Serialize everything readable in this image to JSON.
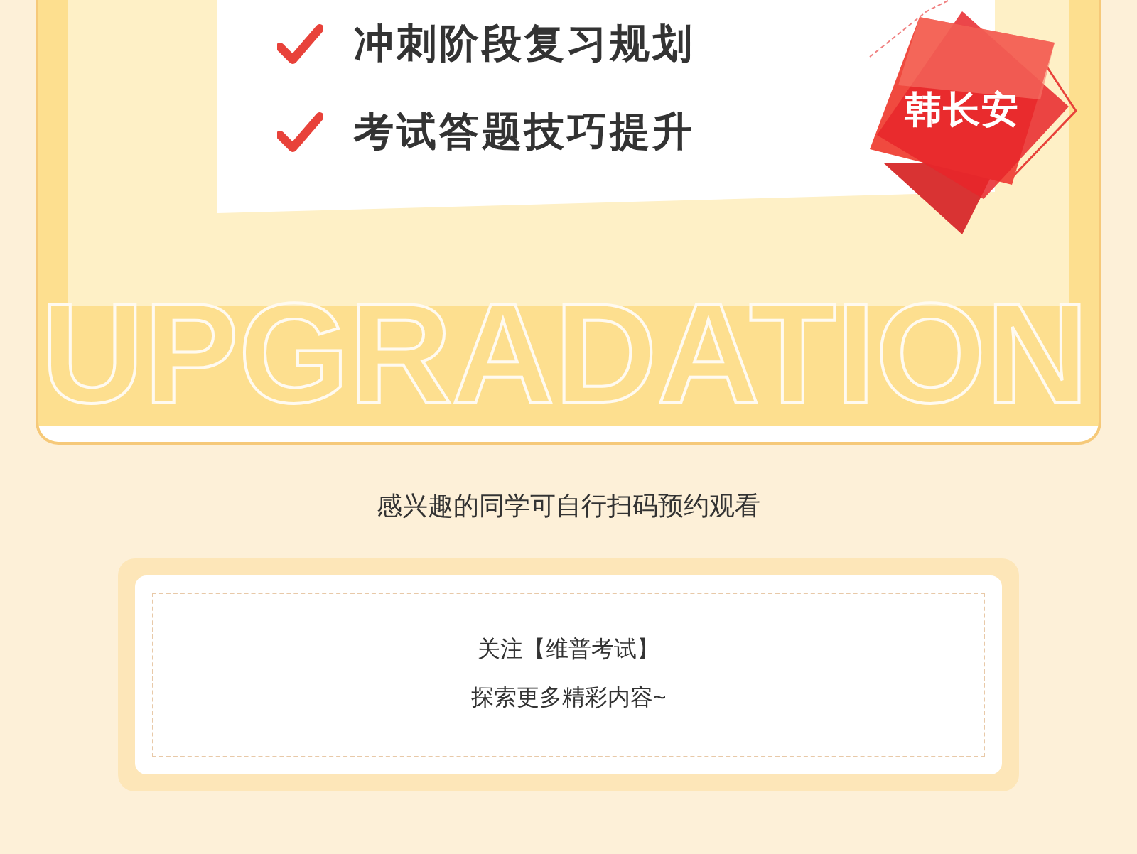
{
  "checklist": [
    {
      "text": "冲刺阶段复习规划"
    },
    {
      "text": "考试答题技巧提升"
    }
  ],
  "badge": {
    "text": "韩长安"
  },
  "watermark": "UPGRADATION",
  "note": "感兴趣的同学可自行扫码预约观看",
  "follow_card": {
    "lines": [
      "关注【维普考试】",
      "探索更多精彩内容~"
    ]
  }
}
